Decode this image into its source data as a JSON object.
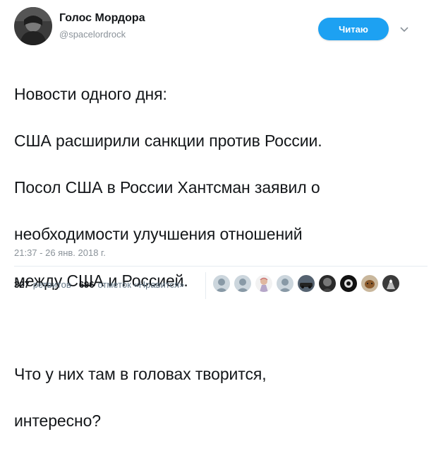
{
  "user": {
    "display_name": "Голос Мордора",
    "handle": "@spacelordrock"
  },
  "follow_button": {
    "label": "Читаю"
  },
  "tweet": {
    "text_lines": [
      "Новости одного дня:",
      "США расширили санкции против России.",
      "Посол США в России Хантсман заявил о",
      "необходимости улучшения отношений",
      "между США и Россией.",
      "",
      "Что у них там в головах творится,",
      "интересно?"
    ],
    "timestamp": "21:37 - 26 янв. 2018 г."
  },
  "stats": {
    "retweets_count": "327",
    "retweets_label": "ретвитов",
    "likes_count": "696",
    "likes_label": "отметок «Нравится»"
  },
  "colors": {
    "accent": "#1da1f2",
    "text": "#14171a",
    "muted": "#8a9299"
  }
}
